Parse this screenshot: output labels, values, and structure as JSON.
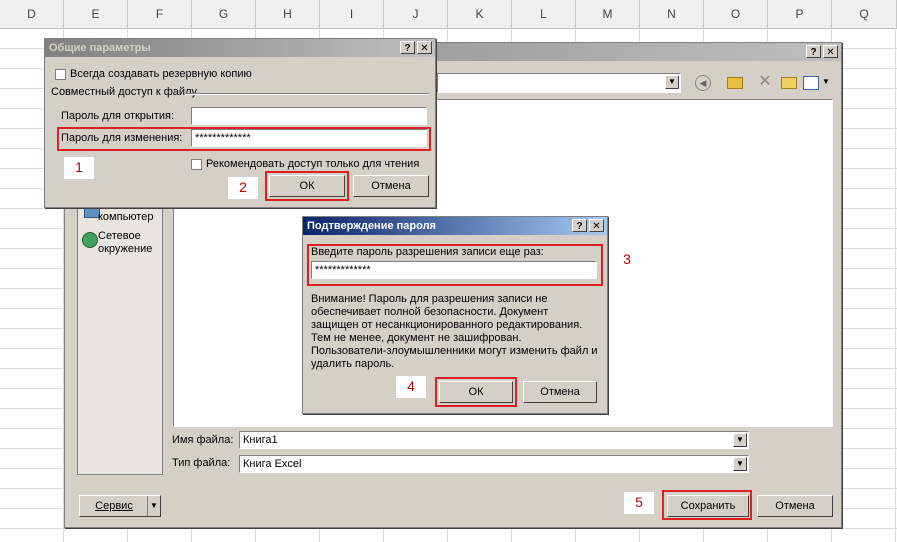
{
  "sheet": {
    "columns": [
      "D",
      "E",
      "F",
      "G",
      "H",
      "I",
      "J",
      "K",
      "L",
      "M",
      "N",
      "O",
      "P",
      "Q"
    ]
  },
  "save_dialog": {
    "sidebar_items": [
      {
        "label": "компьютер"
      },
      {
        "label": "Сетевое окружение"
      }
    ],
    "filename_label": "Имя файла:",
    "filename_value": "Книга1",
    "filetype_label": "Тип файла:",
    "filetype_value": "Книга Excel",
    "tools_label": "Сервис",
    "save_label": "Сохранить",
    "cancel_label": "Отмена",
    "help_label": "?",
    "close_label": "✕"
  },
  "options_dialog": {
    "title": "Общие параметры",
    "backup_label": "Всегда создавать резервную копию",
    "sharing_label": "Совместный доступ к файлу",
    "open_pw_label": "Пароль для открытия:",
    "open_pw_value": "",
    "modify_pw_label": "Пароль для изменения:",
    "modify_pw_value": "*************",
    "readonly_label": "Рекомендовать доступ только для чтения",
    "ok_label": "ОК",
    "cancel_label": "Отмена",
    "help_label": "?",
    "close_label": "✕"
  },
  "confirm_dialog": {
    "title": "Подтверждение пароля",
    "prompt": "Введите пароль разрешения записи еще раз:",
    "password_value": "*************",
    "warning_lines": [
      "Внимание! Пароль для разрешения записи не",
      "обеспечивает полной безопасности. Документ",
      "защищен от несанкционированного редактирования.",
      "Тем не менее, документ не зашифрован.",
      "Пользователи-злоумышленники могут изменить файл и",
      "удалить пароль."
    ],
    "ok_label": "ОК",
    "cancel_label": "Отмена",
    "help_label": "?",
    "close_label": "✕"
  },
  "callouts": [
    "1",
    "2",
    "3",
    "4",
    "5"
  ],
  "colors": {
    "highlight": "#e02020",
    "title_active": "#0a246a",
    "callout_text": "#c00000"
  }
}
